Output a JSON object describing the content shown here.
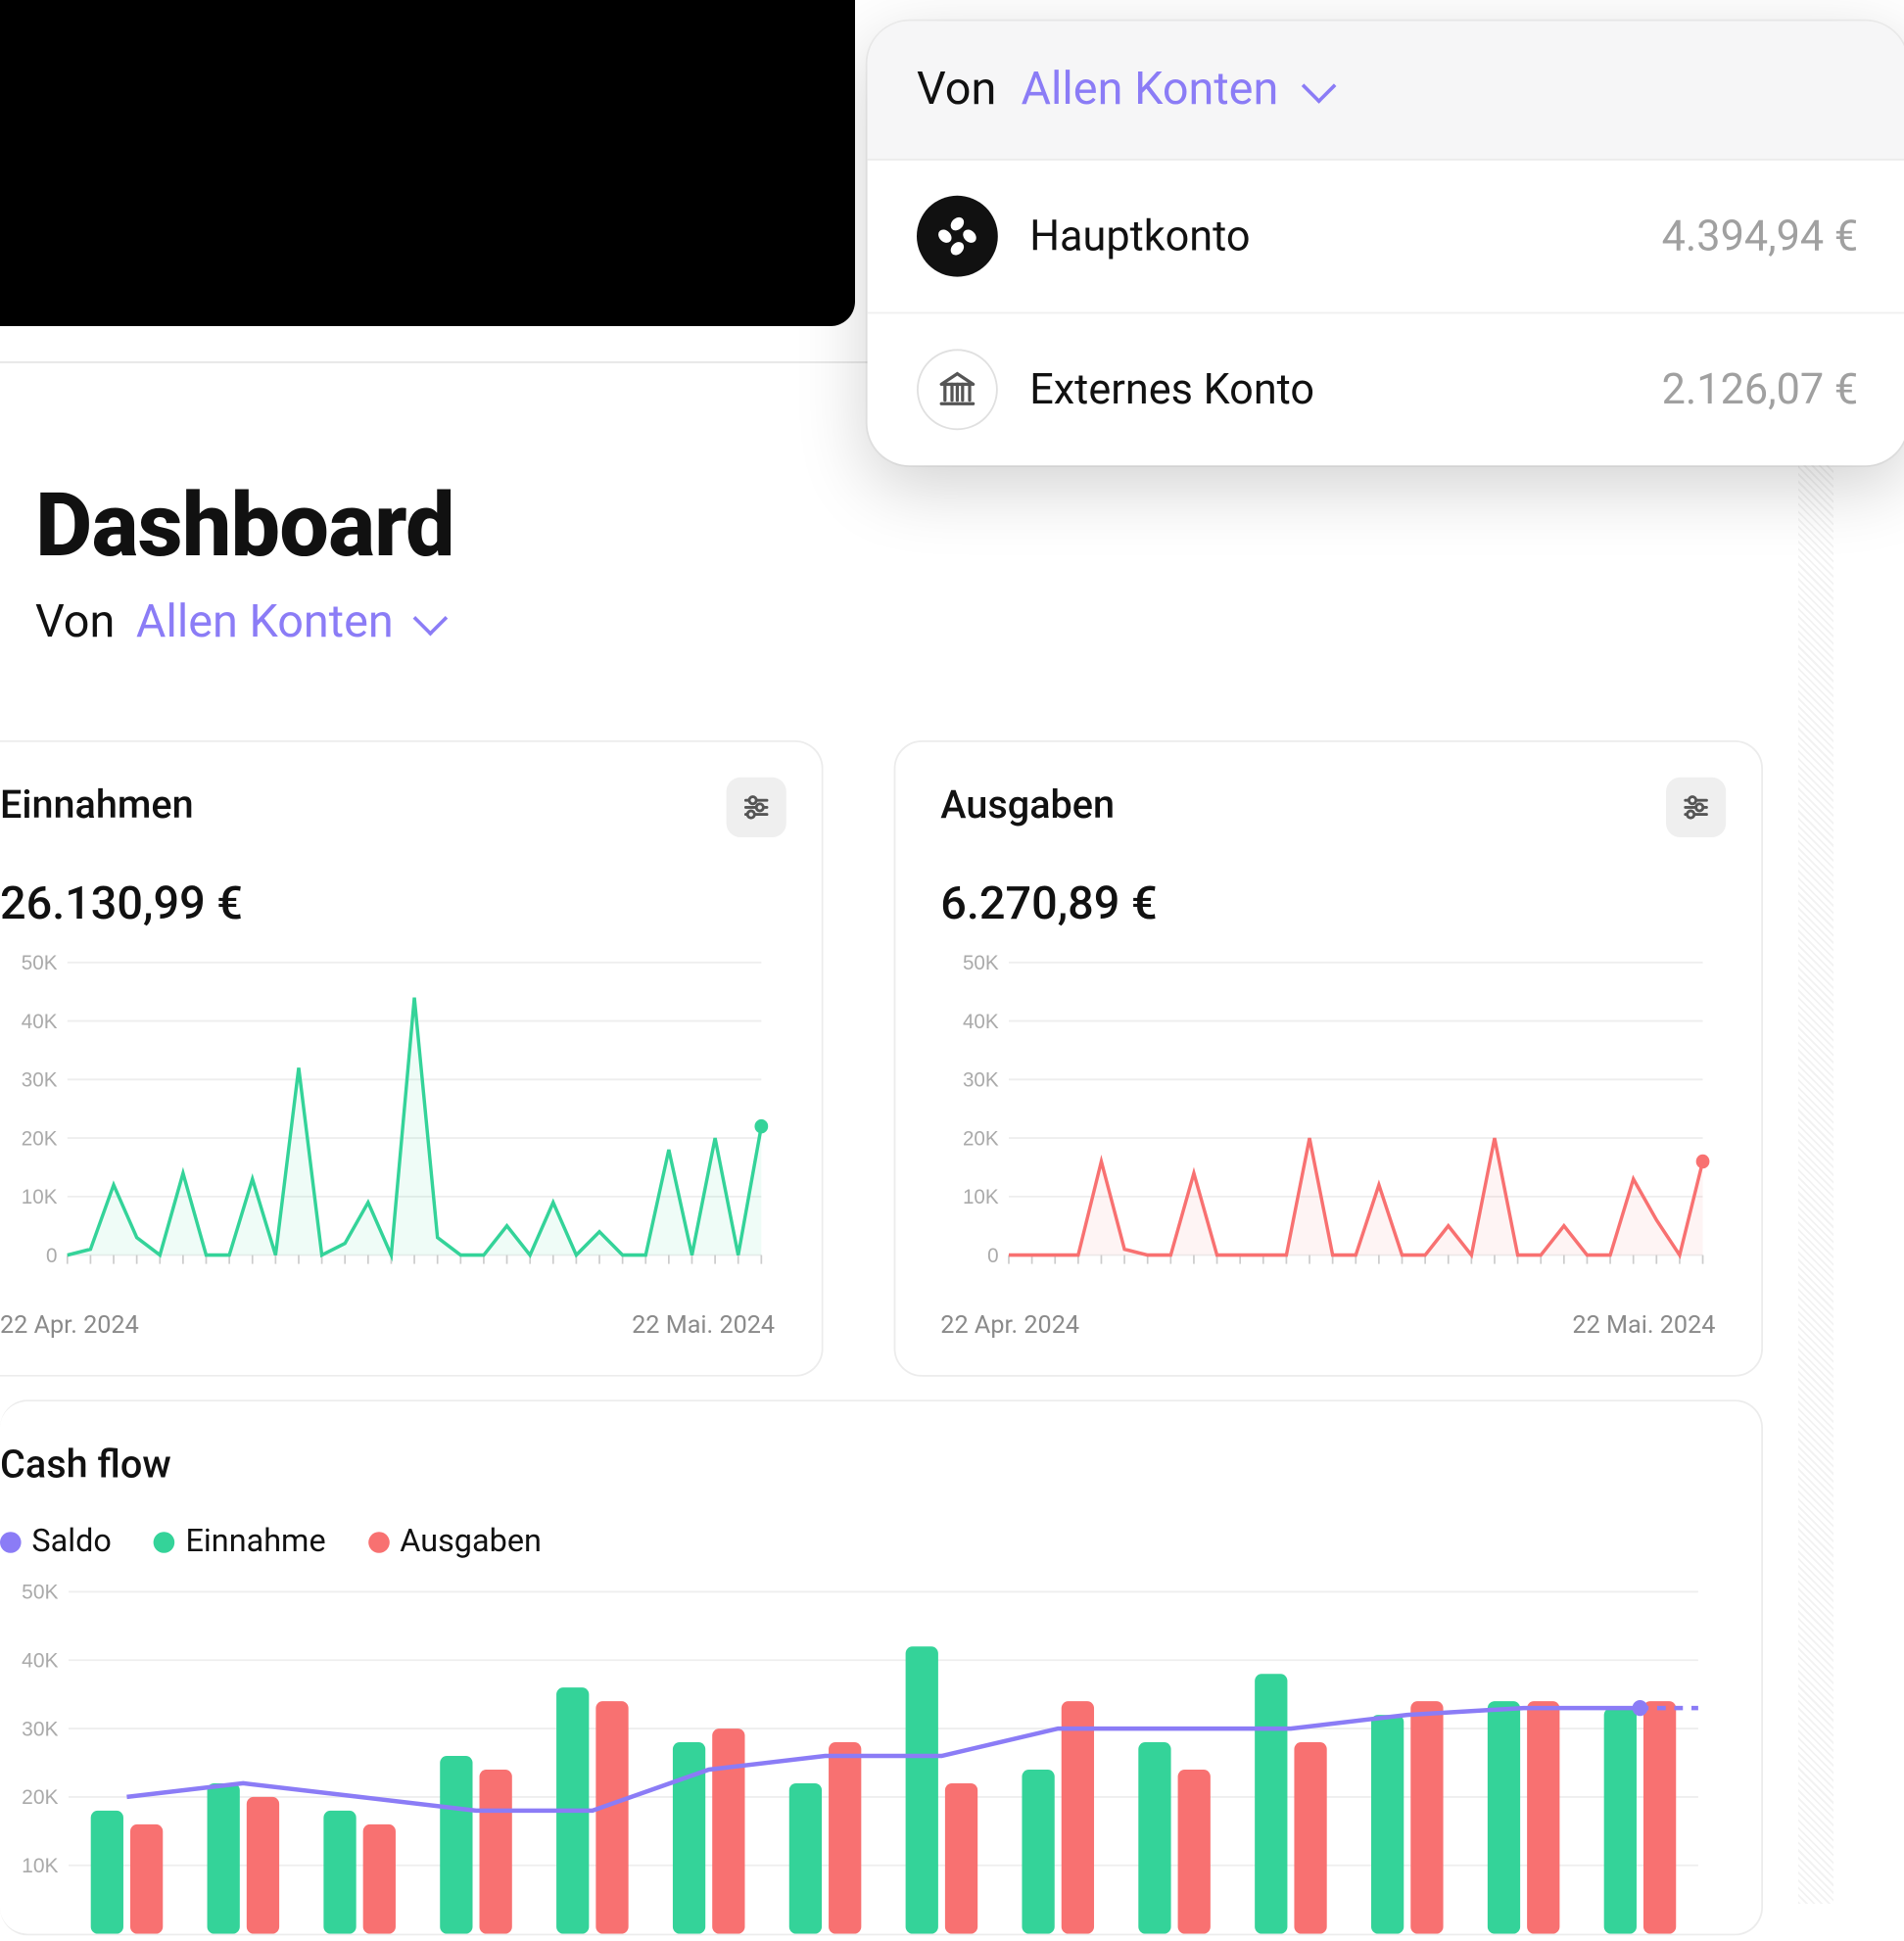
{
  "colors": {
    "accent": "#8b7cf6",
    "income": "#34d399",
    "expense": "#f87171",
    "text": "#111111",
    "muted": "#a0a0a0"
  },
  "page": {
    "title": "Dashboard"
  },
  "filter": {
    "label": "Von",
    "value": "Allen Konten"
  },
  "dropdown": {
    "label": "Von",
    "value": "Allen Konten",
    "items": [
      {
        "icon": "logo-icon",
        "name": "Hauptkonto",
        "amount": "4.394,94 €"
      },
      {
        "icon": "bank-icon",
        "name": "Externes Konto",
        "amount": "2.126,07 €"
      }
    ]
  },
  "cards": {
    "income": {
      "title": "Einnahmen",
      "amount": "26.130,99 €",
      "date_from": "22 Apr. 2024",
      "date_to": "22 Mai. 2024"
    },
    "expense": {
      "title": "Ausgaben",
      "amount": "6.270,89 €",
      "date_from": "22 Apr. 2024",
      "date_to": "22 Mai. 2024"
    }
  },
  "cashflow": {
    "title": "Cash flow",
    "legend": {
      "balance": "Saldo",
      "income": "Einnahme",
      "expense": "Ausgaben"
    }
  },
  "chart_data": [
    {
      "id": "income",
      "type": "line",
      "title": "Einnahmen",
      "ylabel": "",
      "xlabel": "",
      "ylim": [
        0,
        50
      ],
      "y_ticks": [
        "0",
        "10K",
        "20K",
        "30K",
        "40K",
        "50K"
      ],
      "x_range": [
        "22 Apr. 2024",
        "22 Mai. 2024"
      ],
      "x": [
        0,
        1,
        2,
        3,
        4,
        5,
        6,
        7,
        8,
        9,
        10,
        11,
        12,
        13,
        14,
        15,
        16,
        17,
        18,
        19,
        20,
        21,
        22,
        23,
        24,
        25,
        26,
        27,
        28,
        29,
        30
      ],
      "values": [
        0,
        1,
        12,
        3,
        0,
        14,
        0,
        0,
        13,
        0,
        32,
        0,
        2,
        9,
        0,
        44,
        3,
        0,
        0,
        5,
        0,
        9,
        0,
        4,
        0,
        0,
        18,
        0,
        20,
        0,
        22
      ]
    },
    {
      "id": "expense",
      "type": "line",
      "title": "Ausgaben",
      "ylabel": "",
      "xlabel": "",
      "ylim": [
        0,
        50
      ],
      "y_ticks": [
        "0",
        "10K",
        "20K",
        "30K",
        "40K",
        "50K"
      ],
      "x_range": [
        "22 Apr. 2024",
        "22 Mai. 2024"
      ],
      "x": [
        0,
        1,
        2,
        3,
        4,
        5,
        6,
        7,
        8,
        9,
        10,
        11,
        12,
        13,
        14,
        15,
        16,
        17,
        18,
        19,
        20,
        21,
        22,
        23,
        24,
        25,
        26,
        27,
        28,
        29,
        30
      ],
      "values": [
        0,
        0,
        0,
        0,
        16,
        1,
        0,
        0,
        14,
        0,
        0,
        0,
        0,
        20,
        0,
        0,
        12,
        0,
        0,
        5,
        0,
        20,
        0,
        0,
        5,
        0,
        0,
        13,
        6,
        0,
        16
      ]
    },
    {
      "id": "cashflow",
      "type": "bar",
      "title": "Cash flow",
      "ylabel": "",
      "xlabel": "",
      "ylim": [
        0,
        50
      ],
      "y_ticks": [
        "10K",
        "20K",
        "30K",
        "40K",
        "50K"
      ],
      "categories": [
        1,
        2,
        3,
        4,
        5,
        6,
        7,
        8,
        9,
        10,
        11,
        12,
        13,
        14
      ],
      "series": [
        {
          "name": "Einnahme",
          "color": "#34d399",
          "values": [
            18,
            22,
            18,
            26,
            36,
            28,
            22,
            42,
            24,
            28,
            38,
            32,
            34,
            33
          ]
        },
        {
          "name": "Ausgaben",
          "color": "#f87171",
          "values": [
            16,
            20,
            16,
            24,
            34,
            30,
            28,
            22,
            34,
            24,
            28,
            34,
            34,
            34
          ]
        },
        {
          "name": "Saldo",
          "color": "#8b7cf6",
          "values": [
            20,
            22,
            20,
            18,
            18,
            24,
            26,
            26,
            30,
            30,
            30,
            32,
            33,
            33
          ]
        }
      ]
    }
  ]
}
